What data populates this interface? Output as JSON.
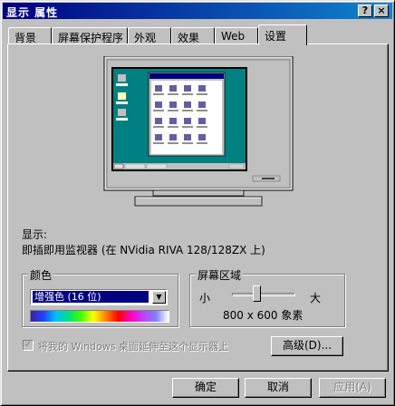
{
  "window": {
    "title": "显示 属性",
    "help_button": "?",
    "close_button": "×"
  },
  "tabs": [
    {
      "label": "背景"
    },
    {
      "label": "屏幕保护程序"
    },
    {
      "label": "外观"
    },
    {
      "label": "效果"
    },
    {
      "label": "Web"
    },
    {
      "label": "设置"
    }
  ],
  "selected_tab": "设置",
  "display": {
    "heading": "显示:",
    "device": "即插即用监视器 (在 NVidia RIVA 128/128ZX 上)"
  },
  "colors": {
    "group_label": "颜色",
    "selected": "增强色 (16 位)"
  },
  "screen_area": {
    "group_label": "屏幕区域",
    "min_label": "小",
    "max_label": "大",
    "value_text": "800 x 600 象素",
    "slider_level": 0.38
  },
  "extend_desktop": {
    "label": "将我的 Windows 桌面延伸至这个显示器上",
    "checked": true,
    "enabled": false
  },
  "buttons": {
    "advanced": "高级(D)...",
    "ok": "确定",
    "cancel": "取消",
    "apply": "应用(A)"
  }
}
